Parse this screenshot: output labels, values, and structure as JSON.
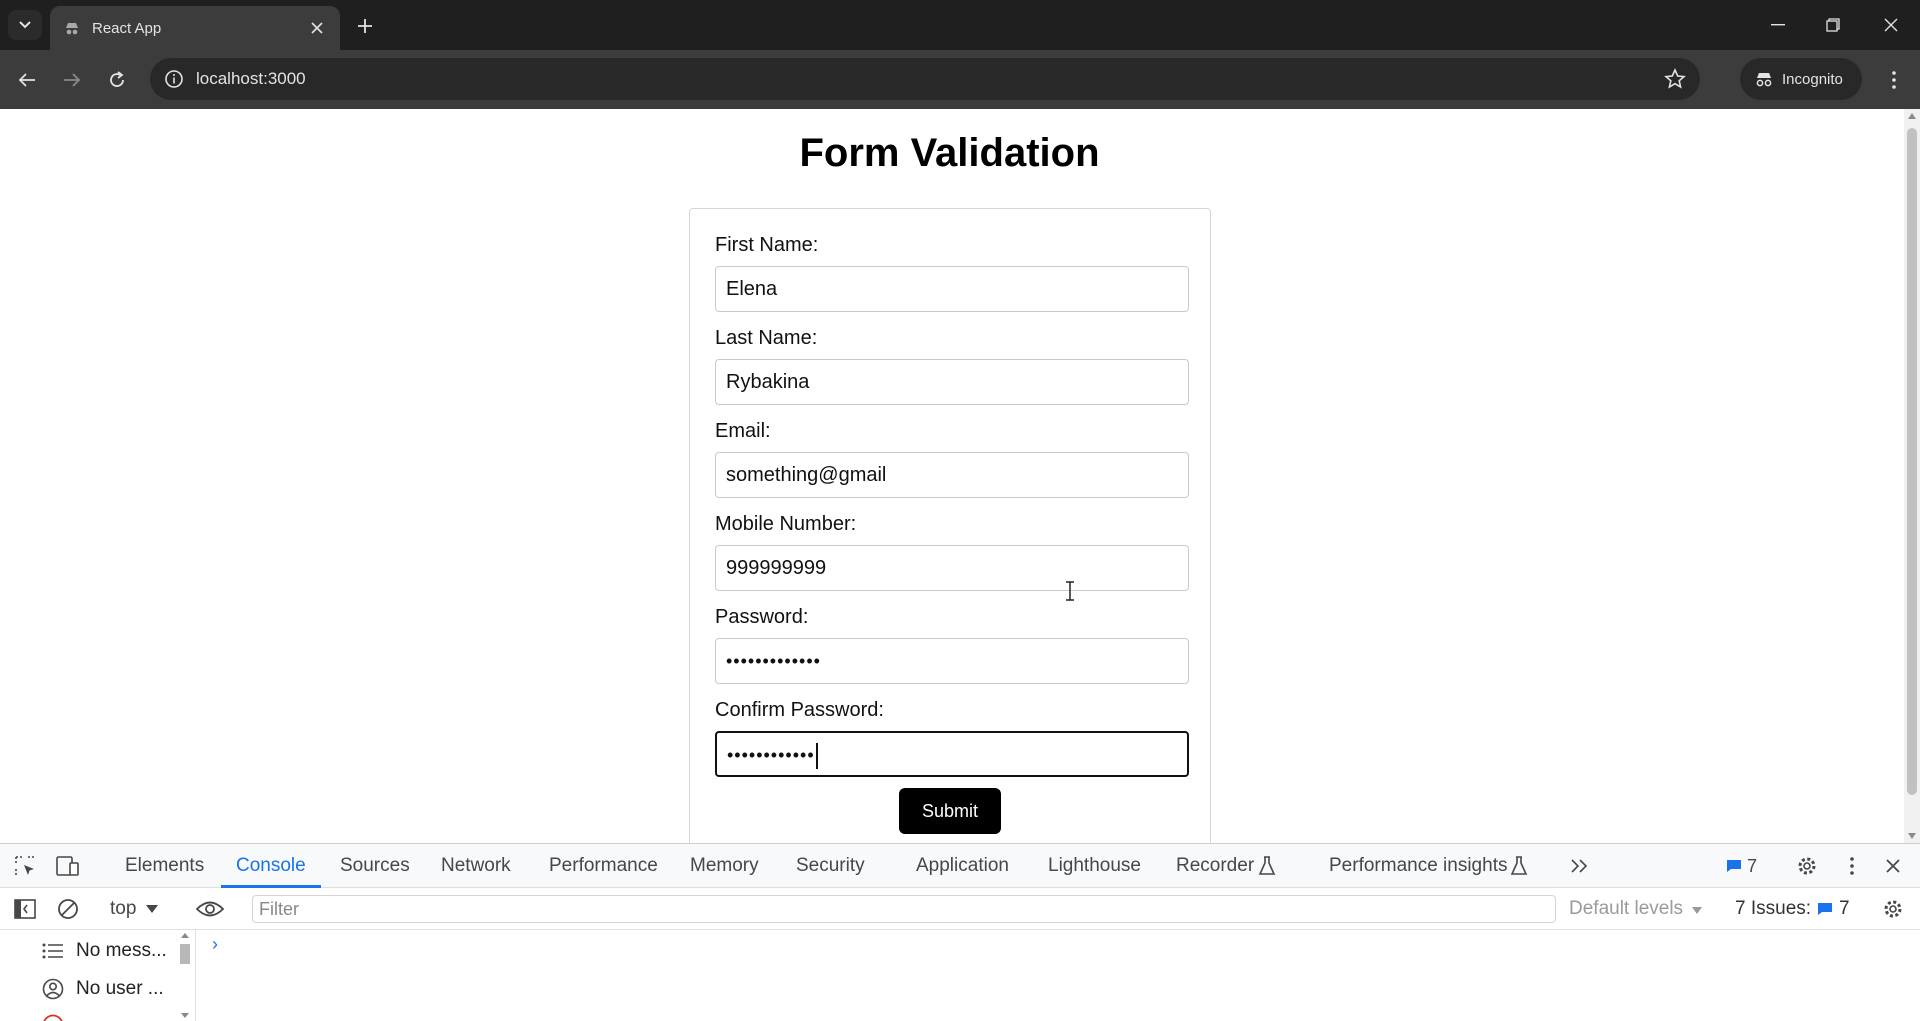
{
  "browser": {
    "tab_title": "React App",
    "url": "localhost:3000",
    "incognito_label": "Incognito"
  },
  "page": {
    "title": "Form Validation",
    "fields": {
      "first_name": {
        "label": "First Name:",
        "value": "Elena"
      },
      "last_name": {
        "label": "Last Name:",
        "value": "Rybakina"
      },
      "email": {
        "label": "Email:",
        "value": "something@gmail"
      },
      "mobile": {
        "label": "Mobile Number:",
        "value": "999999999"
      },
      "password": {
        "label": "Password:",
        "value": "•••••••••••••"
      },
      "confirm_password": {
        "label": "Confirm Password:",
        "value": "••••••••••••"
      }
    },
    "submit_label": "Submit"
  },
  "devtools": {
    "tabs": [
      "Elements",
      "Console",
      "Sources",
      "Network",
      "Performance",
      "Memory",
      "Security",
      "Application",
      "Lighthouse",
      "Recorder",
      "Performance insights"
    ],
    "active_tab": "Console",
    "message_badge_count": "7",
    "context": "top",
    "filter_placeholder": "Filter",
    "levels": "Default levels",
    "issues_label": "7 Issues:",
    "issues_count": "7",
    "sidebar": {
      "messages": "No mess...",
      "user": "No user ..."
    },
    "prompt": "›"
  },
  "colors": {
    "accent": "#1a73e8",
    "chrome_dark": "#1f1f1f",
    "toolbar": "#3c3c3c",
    "submit_bg": "#000000"
  }
}
